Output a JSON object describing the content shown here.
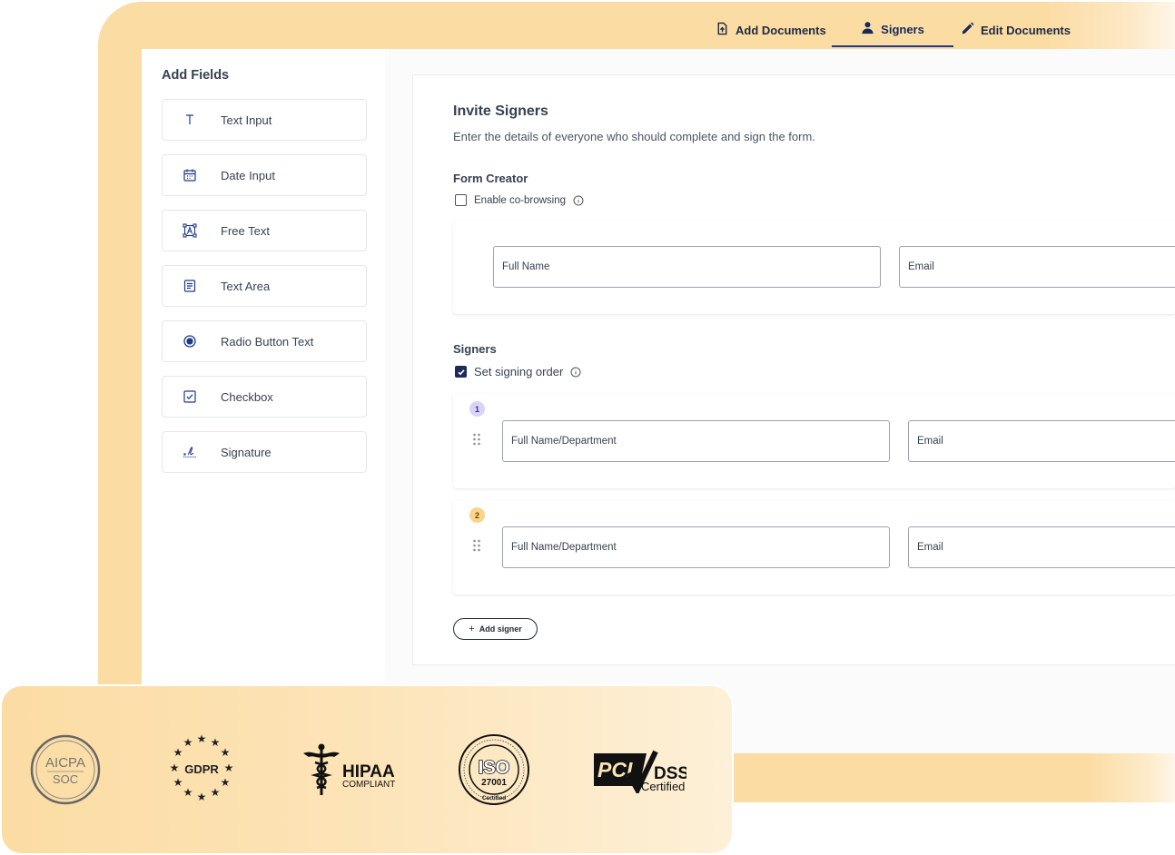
{
  "colors": {
    "frame": "#fbdca3",
    "primary": "#1e3a8a",
    "badge1": "#d9d3f7",
    "badge2": "#f9d48a"
  },
  "nav": {
    "tabs": [
      {
        "label": "Add Documents",
        "icon": "upload-document-icon"
      },
      {
        "label": "Signers",
        "icon": "user-icon",
        "active": true
      },
      {
        "label": "Edit Documents",
        "icon": "pencil-icon"
      }
    ]
  },
  "sidebar": {
    "title": "Add Fields",
    "items": [
      {
        "label": "Text Input",
        "icon": "text-t-icon"
      },
      {
        "label": "Date Input",
        "icon": "calendar-icon"
      },
      {
        "label": "Free Text",
        "icon": "free-text-icon"
      },
      {
        "label": "Text Area",
        "icon": "text-area-icon"
      },
      {
        "label": "Radio Button Text",
        "icon": "radio-icon"
      },
      {
        "label": "Checkbox",
        "icon": "checkbox-icon"
      },
      {
        "label": "Signature",
        "icon": "signature-icon"
      }
    ]
  },
  "main": {
    "title": "Invite Signers",
    "subtitle": "Enter the details of everyone who should complete and sign the form.",
    "form_creator": {
      "title": "Form Creator",
      "cobrowse_label": "Enable co-browsing",
      "cobrowse_checked": false,
      "name_placeholder": "Full Name",
      "email_placeholder": "Email"
    },
    "signers": {
      "title": "Signers",
      "order_label": "Set signing order",
      "order_checked": true,
      "rows": [
        {
          "number": "1",
          "name_placeholder": "Full Name/Department",
          "email_placeholder": "Email"
        },
        {
          "number": "2",
          "name_placeholder": "Full Name/Department",
          "email_placeholder": "Email"
        }
      ],
      "add_label": "Add signer"
    }
  },
  "certifications": {
    "aicpa": {
      "line1": "AICPA",
      "line2": "SOC"
    },
    "gdpr": {
      "label": "GDPR"
    },
    "hipaa": {
      "line1": "HIPAA",
      "line2": "COMPLIANT"
    },
    "iso": {
      "line1": "ISO",
      "line2": "27001",
      "line3": "Certified"
    },
    "pci": {
      "line1": "PCI",
      "line2": "DSS",
      "line3": "Certified"
    }
  }
}
